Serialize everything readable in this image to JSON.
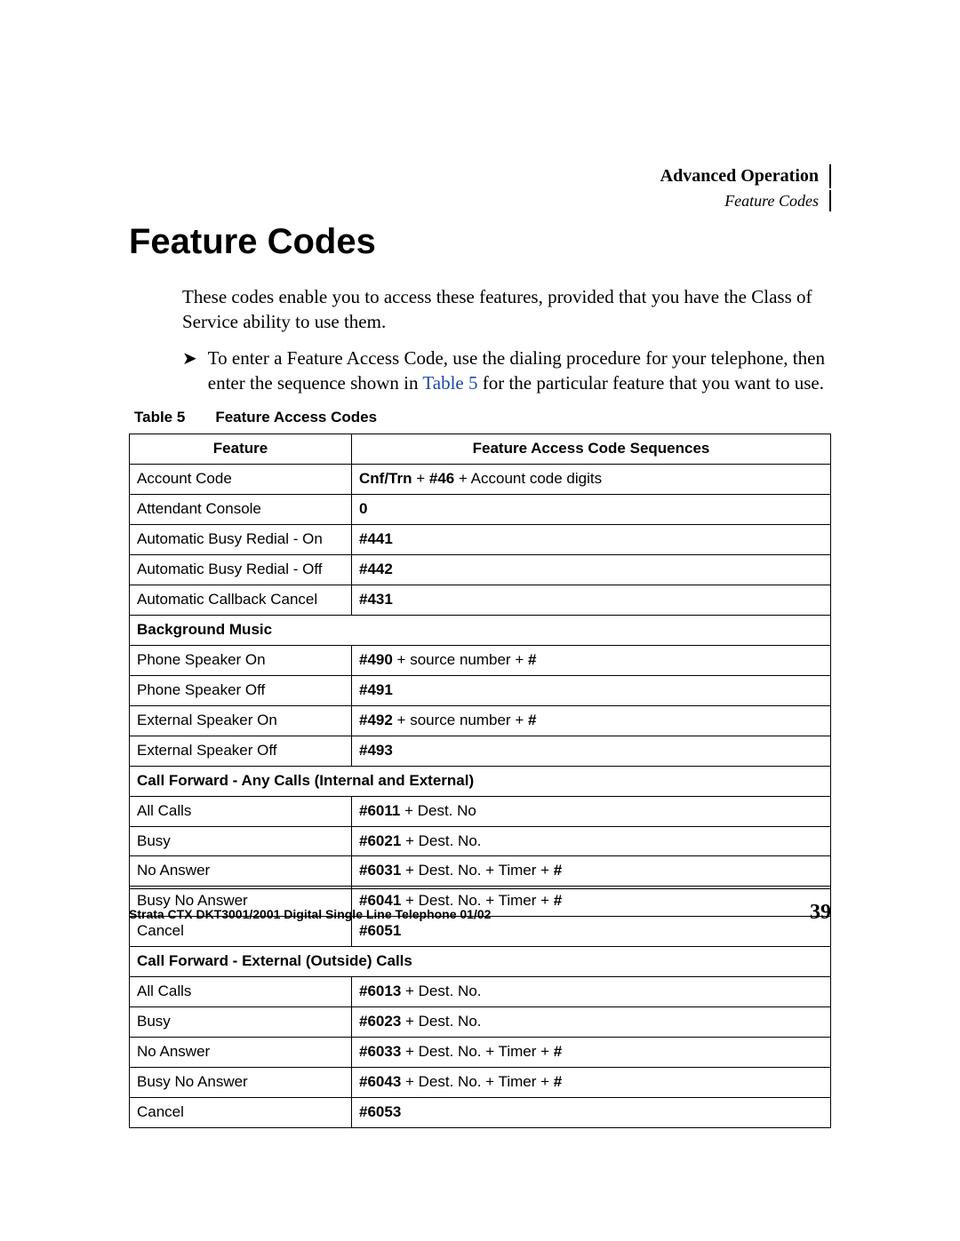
{
  "running_head": {
    "chapter": "Advanced Operation",
    "section": "Feature Codes"
  },
  "title": "Feature Codes",
  "intro": "These codes enable you to access these features, provided that you have the Class of Service ability to use them.",
  "bullet": {
    "pre": "To enter a Feature Access Code, use the dialing procedure for your telephone, then enter the sequence shown in ",
    "link": "Table 5",
    "post": " for the particular feature that you want to use."
  },
  "table": {
    "caption_label": "Table 5",
    "caption_title": "Feature Access Codes",
    "head_feature": "Feature",
    "head_seq": "Feature Access Code Sequences"
  },
  "footer": {
    "doc": "Strata CTX DKT3001/2001 Digital Single Line Telephone    01/02",
    "page": "39"
  },
  "chart_data": {
    "type": "table",
    "title": "Table 5  Feature Access Codes",
    "columns": [
      "Feature",
      "Feature Access Code Sequences"
    ],
    "rows": [
      {
        "feature": "Account Code",
        "sequence": "Cnf/Trn + #46 + Account code digits",
        "bold_parts": [
          "Cnf/Trn",
          "#46"
        ]
      },
      {
        "feature": "Attendant Console",
        "sequence": "0",
        "bold_parts": [
          "0"
        ]
      },
      {
        "feature": "Automatic Busy Redial - On",
        "sequence": "#441",
        "bold_parts": [
          "#441"
        ]
      },
      {
        "feature": "Automatic Busy Redial - Off",
        "sequence": "#442",
        "bold_parts": [
          "#442"
        ]
      },
      {
        "feature": "Automatic Callback Cancel",
        "sequence": "#431",
        "bold_parts": [
          "#431"
        ]
      },
      {
        "section": "Background Music"
      },
      {
        "feature": "Phone Speaker On",
        "indent": true,
        "sequence": "#490 + source number + #",
        "bold_parts": [
          "#490",
          "#"
        ]
      },
      {
        "feature": "Phone Speaker Off",
        "indent": true,
        "sequence": "#491",
        "bold_parts": [
          "#491"
        ]
      },
      {
        "feature": "External Speaker On",
        "indent": true,
        "sequence": "#492 + source number + #",
        "bold_parts": [
          "#492",
          "#"
        ]
      },
      {
        "feature": "External Speaker Off",
        "indent": true,
        "sequence": "#493",
        "bold_parts": [
          "#493"
        ]
      },
      {
        "section": "Call Forward - Any Calls (Internal and External)"
      },
      {
        "feature": "All Calls",
        "indent": true,
        "sequence": "#6011 + Dest. No",
        "bold_parts": [
          "#6011"
        ]
      },
      {
        "feature": "Busy",
        "indent": true,
        "sequence": "#6021 + Dest. No.",
        "bold_parts": [
          "#6021"
        ]
      },
      {
        "feature": "No Answer",
        "indent": true,
        "sequence": "#6031 + Dest. No. + Timer + #",
        "bold_parts": [
          "#6031",
          "#"
        ]
      },
      {
        "feature": "Busy No Answer",
        "indent": true,
        "sequence": "#6041 + Dest. No. + Timer + #",
        "bold_parts": [
          "#6041",
          "#"
        ]
      },
      {
        "feature": "Cancel",
        "indent": true,
        "sequence": "#6051",
        "bold_parts": [
          "#6051"
        ]
      },
      {
        "section": "Call Forward - External (Outside) Calls"
      },
      {
        "feature": "All Calls",
        "indent": true,
        "sequence": "#6013 + Dest. No.",
        "bold_parts": [
          "#6013"
        ]
      },
      {
        "feature": "Busy",
        "indent": true,
        "sequence": "#6023 + Dest. No.",
        "bold_parts": [
          "#6023"
        ]
      },
      {
        "feature": "No Answer",
        "indent": true,
        "sequence": "#6033 + Dest. No. + Timer + #",
        "bold_parts": [
          "#6033",
          "#"
        ]
      },
      {
        "feature": "Busy No Answer",
        "indent": true,
        "sequence": "#6043 + Dest. No. + Timer + #",
        "bold_parts": [
          "#6043",
          "#"
        ]
      },
      {
        "feature": "Cancel",
        "indent": true,
        "sequence": "#6053",
        "bold_parts": [
          "#6053"
        ]
      }
    ]
  }
}
